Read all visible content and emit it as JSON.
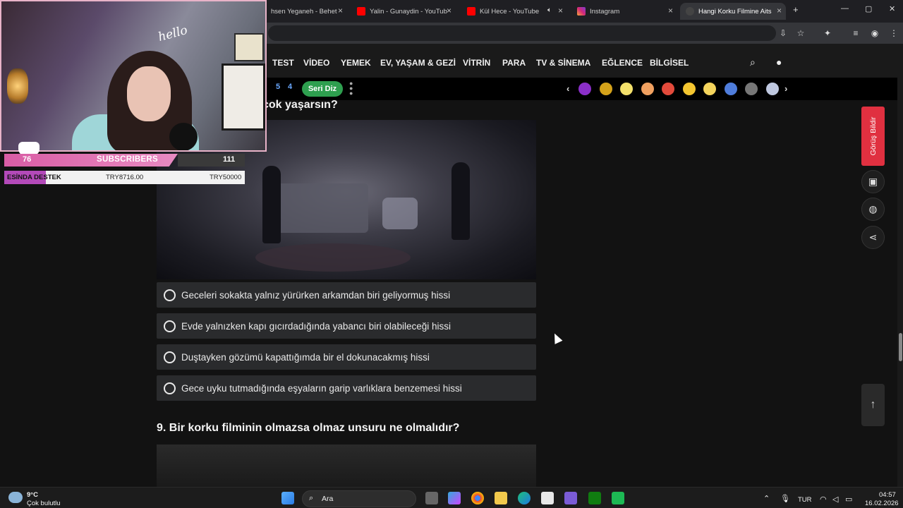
{
  "browser": {
    "tabs": [
      {
        "title": "hsen Yeganeh - Behet",
        "color": "#555"
      },
      {
        "title": "Yalin - Gunaydin - YouTub",
        "color": "#ff0000"
      },
      {
        "title": "Kül Hece - YouTube",
        "color": "#ff0000"
      },
      {
        "title": "Instagram",
        "color": "#d62976"
      },
      {
        "title": "Hangi Korku Filmine Aits",
        "color": "#444"
      }
    ],
    "new_tab": "+",
    "controls": {
      "minimize": "—",
      "maximize": "▢",
      "close": "✕"
    }
  },
  "nav": {
    "items": [
      "TEST",
      "VİDEO",
      "YEMEK",
      "EV, YAŞAM & GEZİ",
      "VİTRİN",
      "PARA",
      "TV & SİNEMA",
      "EĞLENCE",
      "BİLGİSEL"
    ]
  },
  "subbar": {
    "num1": "5",
    "num2": "4",
    "seri_label": "Seri Diz",
    "prev": "‹",
    "next": "›",
    "emoji_colors": [
      "#8b2fc9",
      "#d4a21a",
      "#f3e06b",
      "#f0a060",
      "#e24a3b",
      "#f3c530",
      "#f3d35c",
      "#4f7ddb",
      "#777",
      "#bfc8e0"
    ]
  },
  "quiz": {
    "partial_title": "çok yaşarsın?",
    "options": [
      "Geceleri sokakta yalnız yürürken arkamdan biri geliyormuş hissi",
      "Evde yalnızken kapı gıcırdadığında yabancı biri olabileceği hissi",
      "Duştayken gözümü kapattığımda bir el dokunacakmış hissi",
      "Gece uyku tutmadığında eşyaların garip varlıklara benzemesi hissi"
    ],
    "next_question": "9. Bir korku filminin olmazsa olmaz unsuru ne olmalıdır?"
  },
  "side": {
    "feedback": "Görüş Bildir",
    "to_top": "↑"
  },
  "overlay": {
    "hello": "hello",
    "subs_left": "76",
    "subs_label": "SUBSCRIBERS",
    "subs_right": "111",
    "donation_label": "ESİNDA DESTEK",
    "donation_current": "TRY8716.00",
    "donation_goal": "TRY50000",
    "donation_progress": 0.174
  },
  "taskbar": {
    "weather_temp": "9°C",
    "weather_desc": "Çok bulutlu",
    "search": "Ara",
    "lang": "TUR",
    "time": "04:57",
    "date": "16.02.2026"
  }
}
